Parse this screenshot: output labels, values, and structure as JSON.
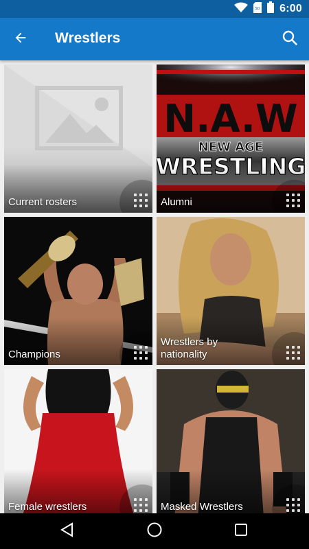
{
  "status_bar": {
    "time": "6:00",
    "icons": [
      "wifi-icon",
      "sd-card-icon",
      "battery-icon"
    ]
  },
  "app_bar": {
    "title": "Wrestlers",
    "back_icon": "arrow-back-icon",
    "search_icon": "search-icon",
    "color": "#1479c9"
  },
  "categories": [
    {
      "label": "Current rosters",
      "image": "placeholder-image-icon"
    },
    {
      "label": "Alumni",
      "image": "naw-new-age-wrestling-logo",
      "logo_text": {
        "top": "N.A.W",
        "middle": "NEW AGE",
        "bottom": "WRESTLING"
      }
    },
    {
      "label": "Champions",
      "image": "wrestler-holding-belt-photo"
    },
    {
      "label": "Wrestlers by nationality",
      "image": "female-wrestler-portrait-photo"
    },
    {
      "label": "Female wrestlers",
      "image": "female-wrestler-red-skirt-photo"
    },
    {
      "label": "Masked Wrestlers",
      "image": "masked-wrestler-photo"
    }
  ],
  "tile_menu_icon": "grid-dots-icon",
  "nav_bar": {
    "icons": [
      "back-triangle-icon",
      "home-circle-icon",
      "recents-square-icon"
    ]
  }
}
